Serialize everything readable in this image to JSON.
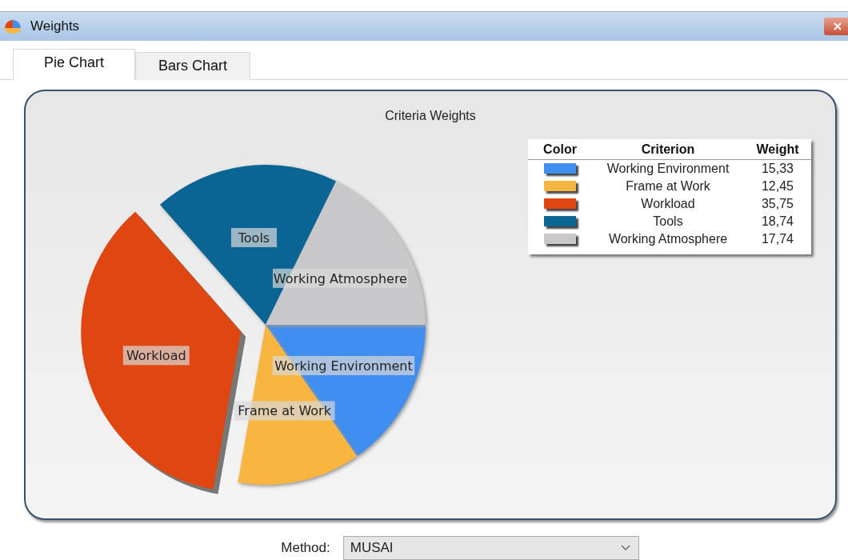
{
  "window": {
    "title": "Weights"
  },
  "tabs": [
    {
      "label": "Pie Chart",
      "selected": true
    },
    {
      "label": "Bars Chart",
      "selected": false
    }
  ],
  "chart": {
    "chart_data": {
      "type": "pie",
      "title": "Criteria Weights",
      "categories": [
        "Working Environment",
        "Frame at Work",
        "Workload",
        "Tools",
        "Working Atmosphere"
      ],
      "values": [
        15.33,
        12.45,
        35.75,
        18.74,
        17.74
      ]
    },
    "legend": {
      "columns": [
        "Color",
        "Criterion",
        "Weight"
      ],
      "rows": [
        {
          "color": "#3f8ef0",
          "criterion": "Working Environment",
          "weight": "15,33"
        },
        {
          "color": "#f8b640",
          "criterion": "Frame at Work",
          "weight": "12,45"
        },
        {
          "color": "#e0460f",
          "criterion": "Workload",
          "weight": "35,75"
        },
        {
          "color": "#0a6494",
          "criterion": "Tools",
          "weight": "18,74"
        },
        {
          "color": "#c8c8ca",
          "criterion": "Working Atmosphere",
          "weight": "17,74"
        }
      ]
    }
  },
  "method": {
    "label": "Method:",
    "value": "MUSAI"
  }
}
